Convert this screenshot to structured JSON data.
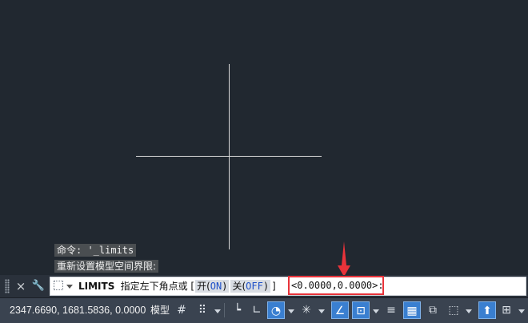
{
  "history": {
    "line1": "命令: '_limits",
    "line2": "重新设置模型空间界限:"
  },
  "commandline": {
    "command": "LIMITS",
    "prompt": "指定左下角点或 [",
    "opt_on_label": "开(",
    "opt_on_kw": "ON",
    "opt_off_label": "关(",
    "opt_off_kw": "OFF",
    "close_bracket": "]",
    "default_value": "<0.0000,0.0000>:",
    "close_icon": "×",
    "customize_icon": "🔧"
  },
  "statusbar": {
    "coordinates": "2347.6690, 1681.5836, 0.0000",
    "model_tab": "模型",
    "grid_icon": "#",
    "snap_icon": "⠿",
    "infer_icon": "┕",
    "ortho_icon": "∟",
    "polar_icon": "◔",
    "osnap_icon": "✳",
    "iso_icon": "∠",
    "dyn_icon": "⊡",
    "lineweight_icon": "≡",
    "transparency_icon": "▦",
    "selection_icon": "⧉",
    "gizmo_icon": "⬚",
    "annotation_icon": "⬆",
    "ucs_icon": "⊞",
    "accent_color": "#3a7fd0",
    "highlight_color": "#e8333a"
  }
}
